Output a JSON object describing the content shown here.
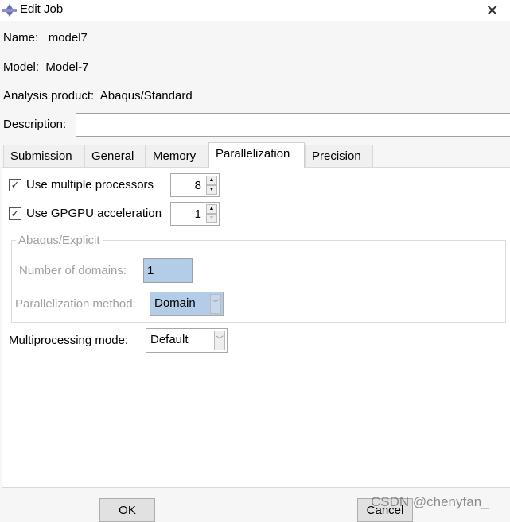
{
  "window": {
    "title": "Edit Job",
    "icon": "abaqus-job-icon"
  },
  "fields": {
    "name_label": "Name:",
    "name_value": "model7",
    "model_label": "Model:",
    "model_value": "Model-7",
    "product_label": "Analysis product:",
    "product_value": "Abaqus/Standard",
    "description_label": "Description:",
    "description_value": ""
  },
  "tabs": [
    {
      "label": "Submission"
    },
    {
      "label": "General"
    },
    {
      "label": "Memory"
    },
    {
      "label": "Parallelization",
      "active": true
    },
    {
      "label": "Precision"
    }
  ],
  "parallelization": {
    "multi_proc": {
      "label": "Use multiple processors",
      "checked": true,
      "value": "8"
    },
    "gpgpu": {
      "label": "Use GPGPU acceleration",
      "checked": true,
      "value": "1"
    },
    "explicit_group": {
      "title": "Abaqus/Explicit",
      "domains_label": "Number of domains:",
      "domains_value": "1",
      "method_label": "Parallelization method:",
      "method_value": "Domain"
    },
    "mode_label": "Multiprocessing mode:",
    "mode_value": "Default"
  },
  "buttons": {
    "ok": "OK",
    "cancel": "Cancel"
  },
  "watermark": "CSDN @chenyfan_",
  "colors": {
    "selected_field": "#b3cde9"
  }
}
